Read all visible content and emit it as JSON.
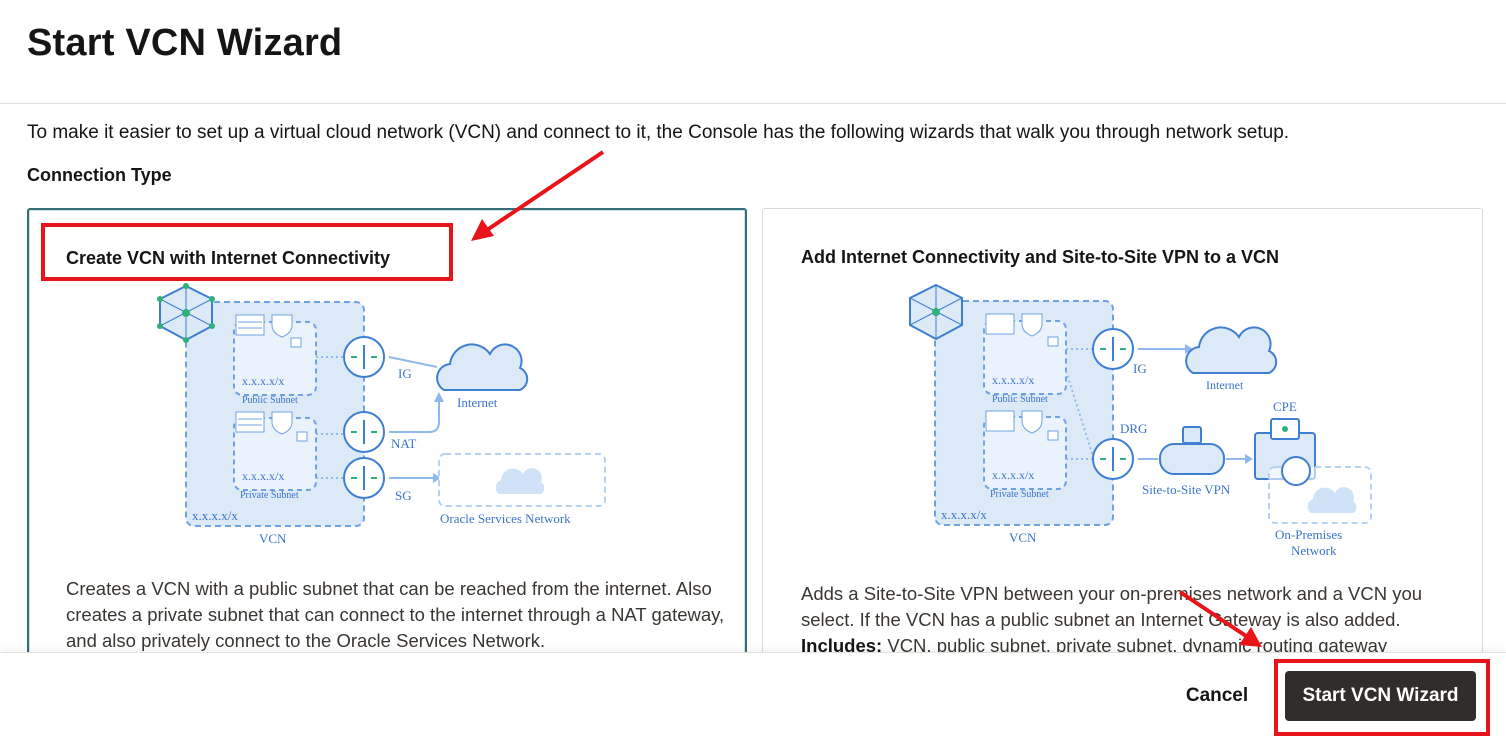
{
  "dialog": {
    "title": "Start VCN Wizard",
    "intro": "To make it easier to set up a virtual cloud network (VCN) and connect to it, the Console has the following wizards that walk you through network setup.",
    "connection_type_label": "Connection Type"
  },
  "cards": [
    {
      "title": "Create VCN with Internet Connectivity",
      "selected": true,
      "description": "Creates a VCN with a public subnet that can be reached from the internet. Also creates a private subnet that can connect to the internet through a NAT gateway, and also privately connect to the Oracle Services Network.",
      "diagram": {
        "public_cidr": "x.x.x.x/x",
        "public_subnet": "Public Subnet",
        "private_cidr": "x.x.x.x/x",
        "private_subnet": "Private Subnet",
        "vcn_cidr": "x.x.x.x/x",
        "vcn": "VCN",
        "ig": "IG",
        "nat": "NAT",
        "sg": "SG",
        "internet": "Internet",
        "osn": "Oracle Services Network"
      }
    },
    {
      "title": "Add Internet Connectivity and Site-to-Site VPN to a VCN",
      "selected": false,
      "description_1": "Adds a Site-to-Site VPN between your on-premises network and a VCN you select. If the VCN has a public subnet an Internet Gateway is also added.",
      "includes_label": "Includes:",
      "includes_text": "VCN, public subnet, private subnet, dynamic routing gateway",
      "diagram": {
        "public_cidr": "x.x.x.x/x",
        "public_subnet": "Public Subnet",
        "private_cidr": "x.x.x.x/x",
        "private_subnet": "Private Subnet",
        "vcn_cidr": "x.x.x.x/x",
        "vcn": "VCN",
        "ig": "IG",
        "drg": "DRG",
        "internet": "Internet",
        "cpe": "CPE",
        "vpn": "Site-to-Site VPN",
        "onprem_1": "On-Premises",
        "onprem_2": "Network"
      }
    }
  ],
  "footer": {
    "cancel_label": "Cancel",
    "start_label": "Start VCN Wizard"
  },
  "annotation_color": "#e8141a"
}
